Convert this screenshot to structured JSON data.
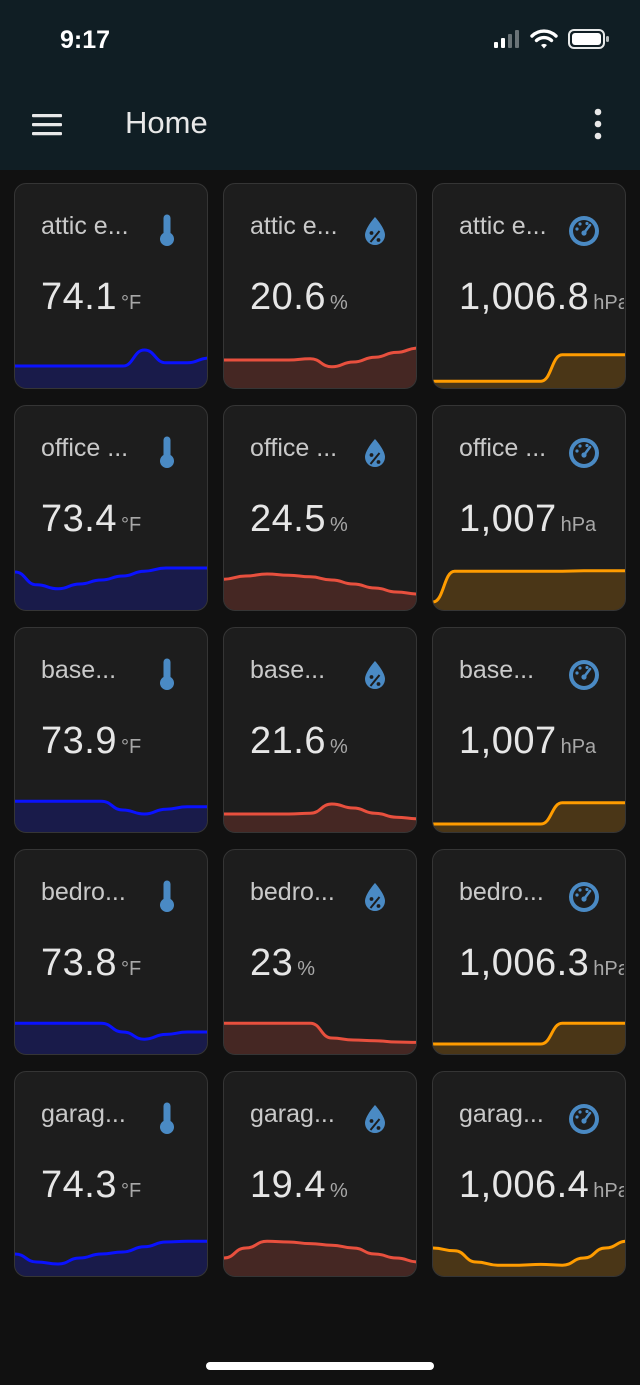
{
  "status_bar": {
    "time": "9:17"
  },
  "header": {
    "title": "Home",
    "menu_icon": "hamburger-menu-icon",
    "more_icon": "more-vertical-icon"
  },
  "colors": {
    "temperature": "#0a12ff",
    "humidity": "#e8503e",
    "pressure": "#ff9c00",
    "icon": "#4a8ac4"
  },
  "cards": [
    {
      "name": "attic e...",
      "type": "temperature",
      "icon": "thermometer-icon",
      "value": "74.1",
      "unit": "°F",
      "trend": [
        0.4,
        0.4,
        0.4,
        0.4,
        0.4,
        0.4,
        0.8,
        0.48,
        0.48,
        0.6
      ]
    },
    {
      "name": "attic e...",
      "type": "humidity",
      "icon": "water-percent-icon",
      "value": "20.6",
      "unit": "%",
      "trend": [
        0.55,
        0.55,
        0.55,
        0.55,
        0.58,
        0.38,
        0.5,
        0.62,
        0.74,
        0.85
      ]
    },
    {
      "name": "attic e...",
      "type": "pressure",
      "icon": "gauge-icon",
      "value": "1,006.8",
      "unit": "hPa",
      "trend": [
        0.02,
        0.02,
        0.02,
        0.02,
        0.02,
        0.02,
        0.68,
        0.68,
        0.68,
        0.68
      ]
    },
    {
      "name": "office ...",
      "type": "temperature",
      "icon": "thermometer-icon",
      "value": "73.4",
      "unit": "°F",
      "trend": [
        0.8,
        0.48,
        0.38,
        0.5,
        0.6,
        0.7,
        0.82,
        0.9,
        0.9,
        0.9
      ]
    },
    {
      "name": "office ...",
      "type": "humidity",
      "icon": "water-percent-icon",
      "value": "24.5",
      "unit": "%",
      "trend": [
        0.62,
        0.7,
        0.75,
        0.72,
        0.68,
        0.6,
        0.5,
        0.4,
        0.3,
        0.25
      ]
    },
    {
      "name": "office ...",
      "type": "pressure",
      "icon": "gauge-icon",
      "value": "1,007",
      "unit": "hPa",
      "trend": [
        0.05,
        0.82,
        0.82,
        0.82,
        0.82,
        0.82,
        0.82,
        0.83,
        0.83,
        0.83
      ]
    },
    {
      "name": "base...",
      "type": "temperature",
      "icon": "thermometer-icon",
      "value": "73.9",
      "unit": "°F",
      "trend": [
        0.62,
        0.62,
        0.62,
        0.62,
        0.62,
        0.4,
        0.3,
        0.42,
        0.48,
        0.48
      ]
    },
    {
      "name": "base...",
      "type": "humidity",
      "icon": "water-percent-icon",
      "value": "21.6",
      "unit": "%",
      "trend": [
        0.3,
        0.3,
        0.3,
        0.3,
        0.32,
        0.55,
        0.45,
        0.32,
        0.22,
        0.18
      ]
    },
    {
      "name": "base...",
      "type": "pressure",
      "icon": "gauge-icon",
      "value": "1,007",
      "unit": "hPa",
      "trend": [
        0.05,
        0.05,
        0.05,
        0.05,
        0.05,
        0.05,
        0.58,
        0.58,
        0.58,
        0.58
      ]
    },
    {
      "name": "bedro...",
      "type": "temperature",
      "icon": "thermometer-icon",
      "value": "73.8",
      "unit": "°F",
      "trend": [
        0.62,
        0.62,
        0.62,
        0.62,
        0.62,
        0.4,
        0.22,
        0.34,
        0.4,
        0.4
      ]
    },
    {
      "name": "bedro...",
      "type": "humidity",
      "icon": "water-percent-icon",
      "value": "23",
      "unit": "%",
      "trend": [
        0.62,
        0.62,
        0.62,
        0.62,
        0.62,
        0.25,
        0.2,
        0.18,
        0.15,
        0.14
      ]
    },
    {
      "name": "bedro...",
      "type": "pressure",
      "icon": "gauge-icon",
      "value": "1,006.3",
      "unit": "hPa",
      "trend": [
        0.1,
        0.1,
        0.1,
        0.1,
        0.1,
        0.1,
        0.62,
        0.62,
        0.62,
        0.62
      ]
    },
    {
      "name": "garag...",
      "type": "temperature",
      "icon": "thermometer-icon",
      "value": "74.3",
      "unit": "°F",
      "trend": [
        0.4,
        0.2,
        0.15,
        0.3,
        0.4,
        0.45,
        0.58,
        0.7,
        0.72,
        0.72
      ]
    },
    {
      "name": "garag...",
      "type": "humidity",
      "icon": "water-percent-icon",
      "value": "19.4",
      "unit": "%",
      "trend": [
        0.3,
        0.55,
        0.72,
        0.7,
        0.66,
        0.62,
        0.55,
        0.4,
        0.3,
        0.2
      ]
    },
    {
      "name": "garag...",
      "type": "pressure",
      "icon": "gauge-icon",
      "value": "1,006.4",
      "unit": "hPa",
      "trend": [
        0.55,
        0.48,
        0.2,
        0.12,
        0.12,
        0.14,
        0.12,
        0.3,
        0.55,
        0.72
      ]
    }
  ]
}
